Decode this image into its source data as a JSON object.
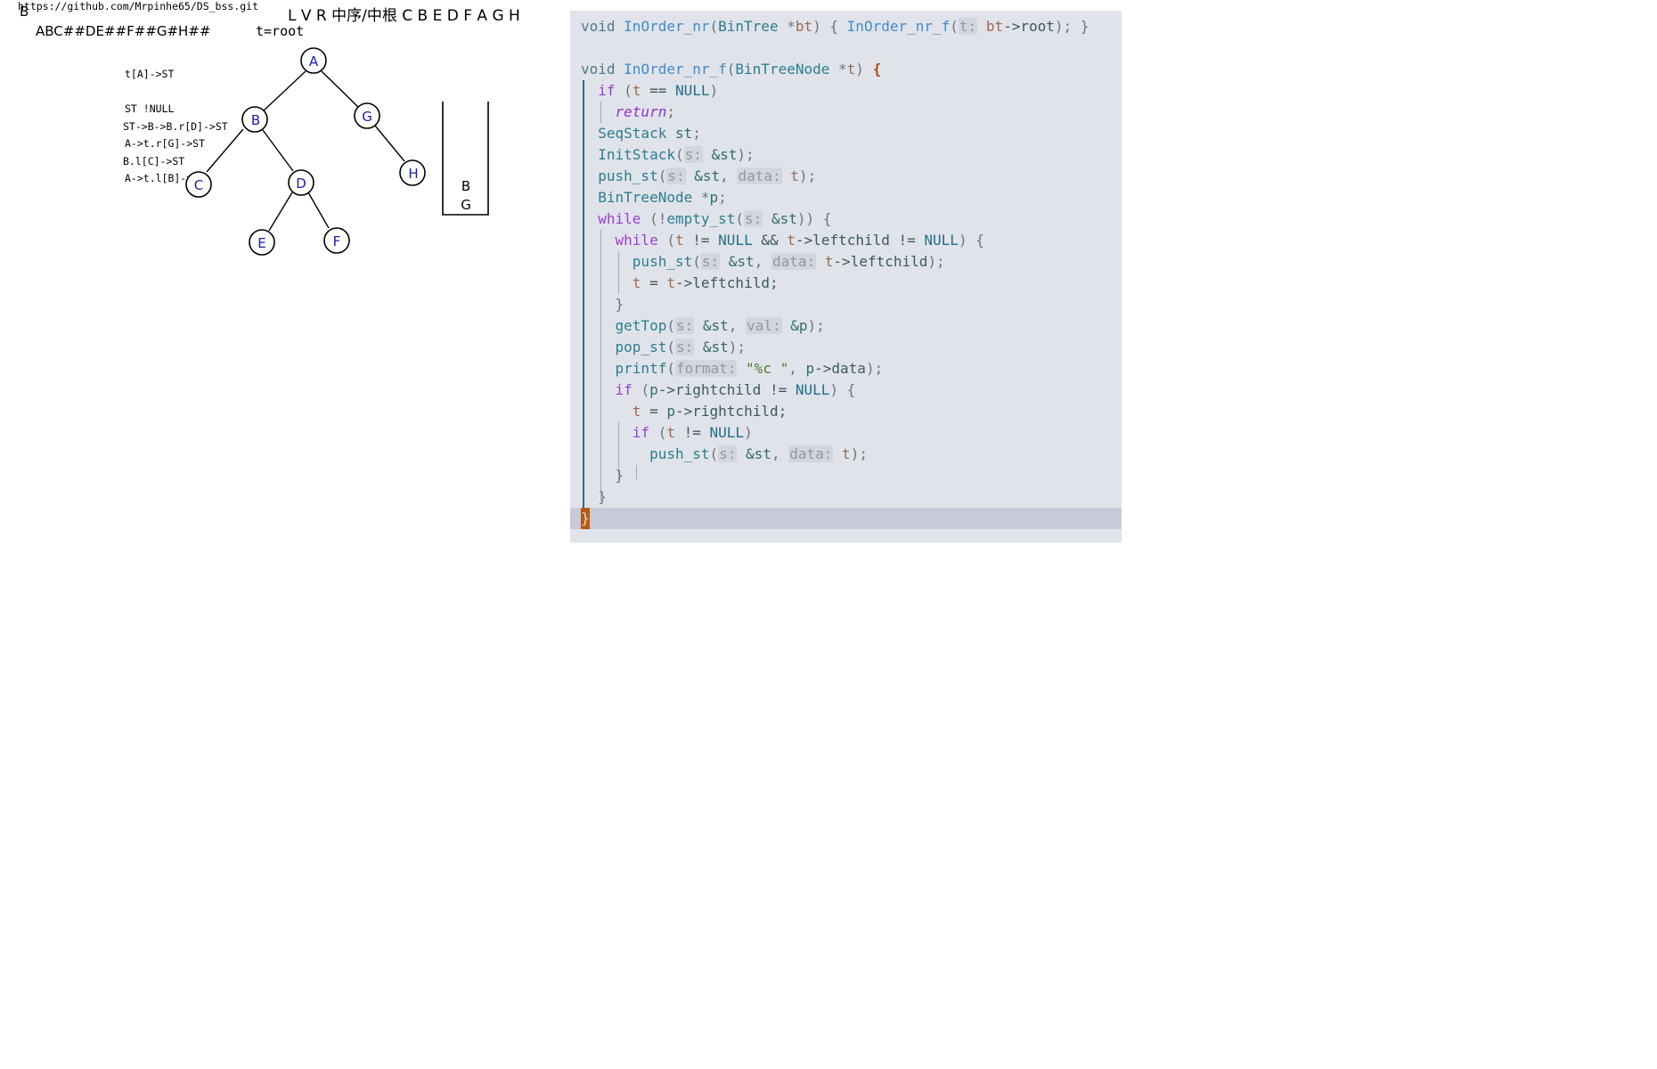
{
  "board": {
    "repo_url": "https://github.com/Mrpinhe65/DS_bss.git",
    "corner_letter": "B",
    "preorder_input": "ABC##DE##F##G#H##",
    "t_root": "t=root",
    "header": "L V R 中序/中根 C B E D F A G H",
    "notes_group1": [
      "t[A]->ST",
      "ST !NULL",
      "A->t.r[G]->ST",
      "A->t.l[B]->ST"
    ],
    "notes_group2": [
      "ST->B->B.r[D]->ST",
      "B.l[C]->ST"
    ],
    "tree_nodes": [
      "A",
      "B",
      "G",
      "C",
      "D",
      "H",
      "E",
      "F"
    ],
    "stack_items": [
      "B",
      "G"
    ],
    "node_color": "#1a1aa8"
  },
  "editor": {
    "background": "#e1e3ea",
    "current_line_bg": "#c7cad9",
    "lines": [
      "void InOrder_nr(BinTree *bt) { InOrder_nr_f(t: bt->root); }",
      "",
      "void InOrder_nr_f(BinTreeNode *t) {",
      "if (t == NULL)",
      "return;",
      "SeqStack st;",
      "InitStack(s: &st);",
      "push_st(s: &st, data: t);",
      "BinTreeNode *p;",
      "while (!empty_st(s: &st)) {",
      "while (t != NULL && t->leftchild != NULL) {",
      "push_st(s: &st, data: t->leftchild);",
      "t = t->leftchild;",
      "}",
      "getTop(s: &st, val: &p);",
      "pop_st(s: &st);",
      "printf(format: \"%c \", p->data);",
      "if (p->rightchild != NULL) {",
      "t = p->rightchild;",
      "if (t != NULL)",
      "push_st(s: &st, data: t);",
      "}",
      "}",
      "}"
    ]
  }
}
